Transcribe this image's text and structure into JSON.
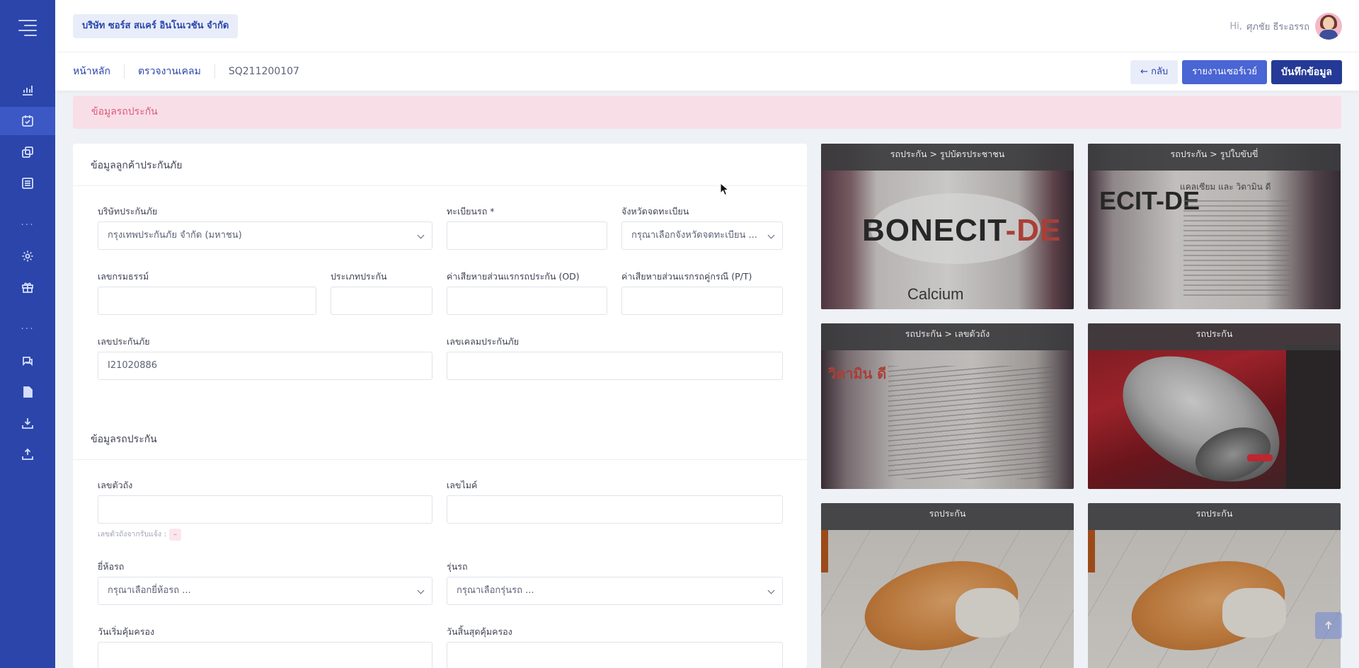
{
  "company": "บริษัท ซอร์ส สแคร์ อินโนเวชัน จำกัด",
  "user": {
    "greeting": "Hi,",
    "name": "ศุภชัย ธีระอรรถ"
  },
  "breadcrumb": [
    "หน้าหลัก",
    "ตรวจงานเคลม",
    "SQ211200107"
  ],
  "actions": {
    "back": "← กลับ",
    "survey_report": "รายงานเซอร์เวย์",
    "save": "บันทึกข้อมูล"
  },
  "alert_title": "ข้อมูลรถประกัน",
  "section_customer": {
    "title": "ข้อมูลลูกค้าประกันภัย",
    "insurer_label": "บริษัทประกันภัย",
    "insurer_value": "กรุงเทพประกันภัย จำกัด (มหาชน)",
    "plate_label": "ทะเบียนรถ *",
    "plate_value": "",
    "province_label": "จังหวัดจดทะเบียน",
    "province_placeholder": "กรุณาเลือกจังหวัดจดทะเบียน ...",
    "policy_label": "เลขกรมธรรม์",
    "policy_value": "",
    "insurance_type_label": "ประเภทประกัน",
    "insurance_type_value": "",
    "od_label": "ค่าเสียหายส่วนแรกรถประกัน (OD)",
    "od_value": "",
    "pt_label": "ค่าเสียหายส่วนแรกรถคู่กรณี (P/T)",
    "pt_value": "",
    "insurance_no_label": "เลขประกันภัย",
    "insurance_no_value": "I21020886",
    "claim_no_label": "เลขเคลมประกันภัย",
    "claim_no_value": ""
  },
  "section_vehicle": {
    "title": "ข้อมูลรถประกัน",
    "chassis_label": "เลขตัวถัง",
    "chassis_value": "",
    "chassis_hint": "เลขตัวถังจากรับแจ้ง :",
    "chassis_hint_value": "–",
    "mileage_label": "เลขไมค์",
    "mileage_value": "",
    "brand_label": "ยี่ห้อรถ",
    "brand_placeholder": "กรุณาเลือกยี่ห้อรถ ...",
    "model_label": "รุ่นรถ",
    "model_placeholder": "กรุณาเลือกรุ่นรถ ...",
    "start_label": "วันเริ่มคุ้มครอง",
    "end_label": "วันสิ้นสุดคุ้มครอง"
  },
  "photos": [
    {
      "caption": "รถประกัน > รูปบัตรประชาชน",
      "scene": "bottle-front"
    },
    {
      "caption": "รถประกัน > รูปใบขับขี่",
      "scene": "bottle-side"
    },
    {
      "caption": "รถประกัน > เลขตัวถัง",
      "scene": "bottle-back"
    },
    {
      "caption": "รถประกัน",
      "scene": "cat-tabby"
    },
    {
      "caption": "รถประกัน",
      "scene": "cat-orange"
    },
    {
      "caption": "รถประกัน",
      "scene": "cat-orange"
    }
  ],
  "photo_texts": {
    "brand": "BONECIT",
    "brand_suffix": "-DE",
    "sub": "Calcium",
    "crop": "ECIT-DE",
    "thai": "แคลเซียม และ วิตามิน ดี",
    "thai_crop": "วิตามิน ดี"
  },
  "colors": {
    "sidebar": "#2b45ab",
    "primary": "#4a65d4",
    "dark_button": "#243a96",
    "alert_bg": "#f8dfe7",
    "alert_text": "#e0587e"
  },
  "icons": [
    "menu-icon",
    "chart-icon",
    "calendar-check-icon",
    "copy-icon",
    "list-icon",
    "gear-icon",
    "gift-icon",
    "chat-icon",
    "document-icon",
    "download-icon",
    "upload-icon",
    "arrow-up-icon"
  ]
}
